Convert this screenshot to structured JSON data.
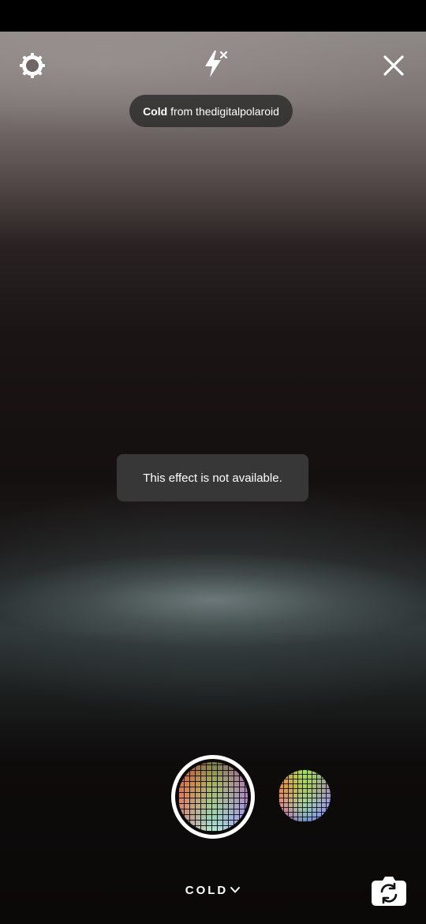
{
  "toolbar": {
    "settings_icon": "settings-gear-icon",
    "flash_icon": "flash-off-icon",
    "close_icon": "close-icon"
  },
  "effect_pill": {
    "effect_name": "Cold",
    "attribution": "from thedigitalpolaroid"
  },
  "toast": {
    "message": "This effect is not available."
  },
  "bottom": {
    "effect_label": "COLD",
    "flip_camera_icon": "flip-camera-icon"
  },
  "colors": {
    "toast_bg": "#383737",
    "pill_bg": "#282626",
    "ring": "#ffffff"
  }
}
